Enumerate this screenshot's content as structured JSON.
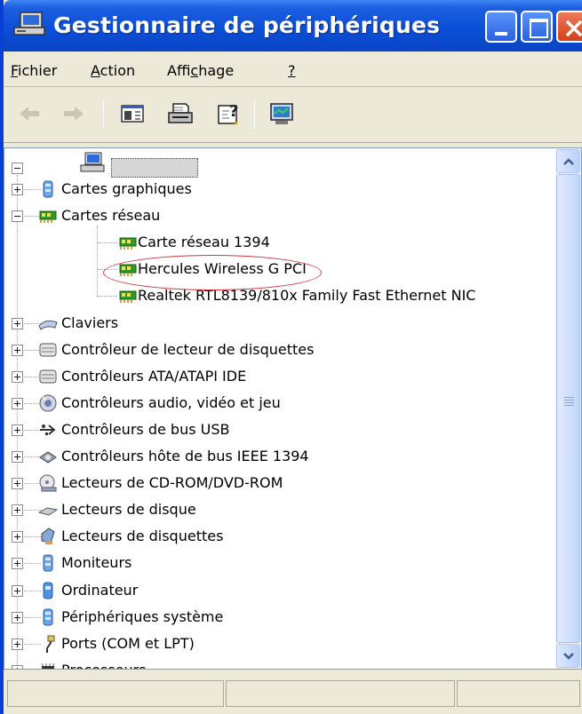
{
  "window": {
    "title": "Gestionnaire de périphériques"
  },
  "menu": [
    {
      "pre": "",
      "ul": "F",
      "post": "ichier"
    },
    {
      "pre": "",
      "ul": "A",
      "post": "ction"
    },
    {
      "pre": "Affi",
      "ul": "c",
      "post": "hage"
    },
    {
      "pre": "",
      "ul": "?",
      "post": ""
    }
  ],
  "toolbar": [
    "back-arrow-icon",
    "forward-arrow-icon",
    "show-hide-console-tree-icon",
    "print-icon",
    "properties-help-icon",
    "scan-hardware-icon"
  ],
  "tree": {
    "root_label": "",
    "items": [
      {
        "label": "Cartes graphiques",
        "icon": "display-adapter-icon",
        "expanded": false
      },
      {
        "label": "Cartes réseau",
        "icon": "network-card-icon",
        "expanded": true,
        "children": [
          {
            "label": "Carte réseau 1394",
            "icon": "network-card-icon"
          },
          {
            "label": "Hercules Wireless G PCI",
            "icon": "network-card-icon",
            "highlighted": true
          },
          {
            "label": "Realtek RTL8139/810x Family Fast Ethernet NIC",
            "icon": "network-card-icon"
          }
        ]
      },
      {
        "label": "Claviers",
        "icon": "keyboard-icon",
        "expanded": false
      },
      {
        "label": "Contrôleur de lecteur de disquettes",
        "icon": "floppy-controller-icon",
        "expanded": false
      },
      {
        "label": "Contrôleurs ATA/ATAPI IDE",
        "icon": "ide-controller-icon",
        "expanded": false
      },
      {
        "label": "Contrôleurs audio, vidéo et jeu",
        "icon": "audio-icon",
        "expanded": false
      },
      {
        "label": "Contrôleurs de bus USB",
        "icon": "usb-icon",
        "expanded": false
      },
      {
        "label": "Contrôleurs hôte de bus IEEE 1394",
        "icon": "ieee1394-icon",
        "expanded": false
      },
      {
        "label": "Lecteurs de CD-ROM/DVD-ROM",
        "icon": "cdrom-icon",
        "expanded": false
      },
      {
        "label": "Lecteurs de disque",
        "icon": "disk-drive-icon",
        "expanded": false
      },
      {
        "label": "Lecteurs de disquettes",
        "icon": "floppy-drive-icon",
        "expanded": false
      },
      {
        "label": "Moniteurs",
        "icon": "monitor-icon",
        "expanded": false
      },
      {
        "label": "Ordinateur",
        "icon": "computer-icon",
        "expanded": false
      },
      {
        "label": "Périphériques système",
        "icon": "system-devices-icon",
        "expanded": false
      },
      {
        "label": "Ports (COM et LPT)",
        "icon": "ports-icon",
        "expanded": false
      },
      {
        "label": "Processeurs",
        "icon": "processor-icon",
        "expanded": false
      }
    ]
  },
  "colors": {
    "titlebar": "#0b4fd8",
    "highlight": "#d2373f",
    "chrome": "#ece9d8"
  }
}
